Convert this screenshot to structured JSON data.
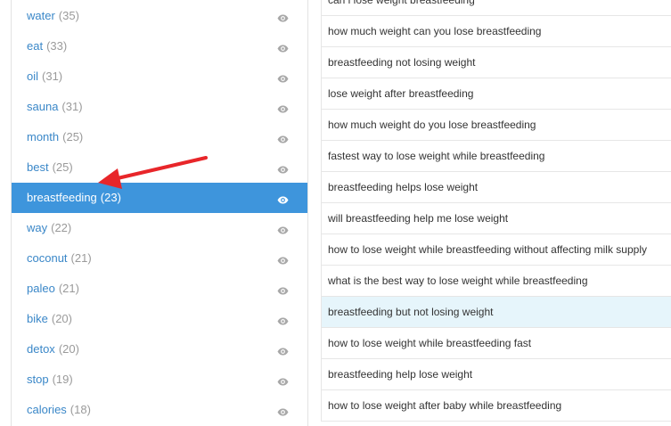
{
  "keywords": [
    {
      "word": "water",
      "count": "(35)"
    },
    {
      "word": "eat",
      "count": "(33)"
    },
    {
      "word": "oil",
      "count": "(31)"
    },
    {
      "word": "sauna",
      "count": "(31)"
    },
    {
      "word": "month",
      "count": "(25)"
    },
    {
      "word": "best",
      "count": "(25)"
    },
    {
      "word": "breastfeeding",
      "count": "(23)"
    },
    {
      "word": "way",
      "count": "(22)"
    },
    {
      "word": "coconut",
      "count": "(21)"
    },
    {
      "word": "paleo",
      "count": "(21)"
    },
    {
      "word": "bike",
      "count": "(20)"
    },
    {
      "word": "detox",
      "count": "(20)"
    },
    {
      "word": "stop",
      "count": "(19)"
    },
    {
      "word": "calories",
      "count": "(18)"
    }
  ],
  "active_keyword_index": 6,
  "phrases": [
    "can i lose weight breastfeeding",
    "how much weight can you lose breastfeeding",
    "breastfeeding not losing weight",
    "lose weight after breastfeeding",
    "how much weight do you lose breastfeeding",
    "fastest way to lose weight while breastfeeding",
    "breastfeeding helps lose weight",
    "will breastfeeding help me lose weight",
    "how to lose weight while breastfeeding without affecting milk supply",
    "what is the best way to lose weight while breastfeeding",
    "breastfeeding but not losing weight",
    "how to lose weight while breastfeeding fast",
    "breastfeeding help lose weight",
    "how to lose weight after baby while breastfeeding"
  ],
  "highlighted_phrase_index": 10,
  "colors": {
    "accent": "#3e95dc",
    "link": "#3a87c8",
    "count": "#9a9a9a",
    "highlight_row": "#e6f5fb",
    "annotation_arrow": "#e8262a"
  },
  "icons": {
    "row_icon": "eye-icon"
  }
}
